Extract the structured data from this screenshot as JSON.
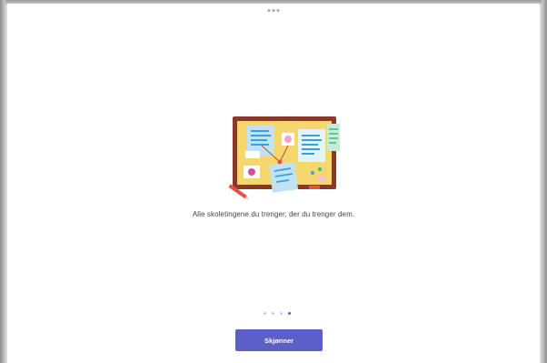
{
  "window": {
    "more_menu_icon": "more-horizontal-icon"
  },
  "onboarding": {
    "illustration": "bulletin-board-illustration",
    "caption": "Alle skoletingene du trenger, der du trenger dem.",
    "page_count": 4,
    "current_page": 4,
    "primary_button_label": "Skjønner"
  },
  "colors": {
    "accent": "#5b5fc7",
    "board_frame": "#8b3a2a",
    "board_cork": "#f5d76e",
    "note_blue": "#bfe3f5",
    "note_green": "#c8ecd8",
    "note_pink": "#f6c1d4",
    "pin_red": "#e0534b"
  }
}
